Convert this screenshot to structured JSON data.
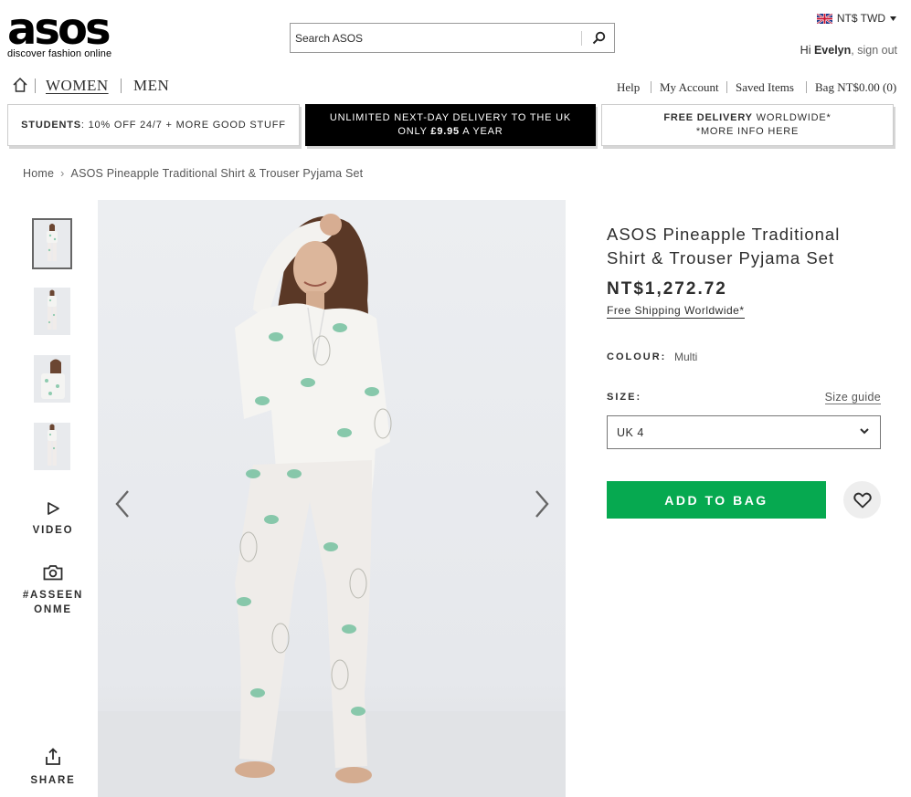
{
  "header": {
    "logo_word": "asos",
    "logo_tagline": "discover fashion online",
    "search_placeholder": "Search ASOS",
    "currency": "NT$ TWD",
    "greeting_prefix": "Hi ",
    "user_name": "Evelyn",
    "signout": ", sign out"
  },
  "nav": {
    "women": "WOMEN",
    "men": "MEN",
    "help": "Help",
    "account": "My Account",
    "saved": "Saved Items",
    "bag": "Bag NT$0.00 (0)"
  },
  "promos": {
    "students_bold": "STUDENTS",
    "students_rest": ": 10% OFF 24/7 + MORE GOOD STUFF",
    "delivery_line1": "UNLIMITED NEXT-DAY DELIVERY TO THE UK",
    "delivery_line2_a": "ONLY ",
    "delivery_line2_b": "£9.95",
    "delivery_line2_c": " A YEAR",
    "free_bold": "FREE DELIVERY",
    "free_rest": " WORLDWIDE*",
    "free_line2": "*MORE INFO HERE"
  },
  "breadcrumb": {
    "home": "Home",
    "sep": "›",
    "current": "ASOS Pineapple Traditional Shirt & Trouser Pyjama Set"
  },
  "gallery": {
    "video_label": "VIDEO",
    "asseen_line1": "#ASSEEN",
    "asseen_line2": "ONME",
    "share_label": "SHARE"
  },
  "product": {
    "name": "ASOS Pineapple Traditional Shirt & Trouser Pyjama Set",
    "price": "NT$1,272.72",
    "shipping": "Free Shipping Worldwide*",
    "colour_label": "COLOUR:",
    "colour_value": "Multi",
    "size_label": "SIZE:",
    "size_guide": "Size guide",
    "size_selected": "UK 4",
    "add_to_bag": "ADD TO BAG"
  },
  "colors": {
    "accent_green": "#06a950",
    "promo_dark": "#000000",
    "print_green": "#7cc4a4"
  }
}
